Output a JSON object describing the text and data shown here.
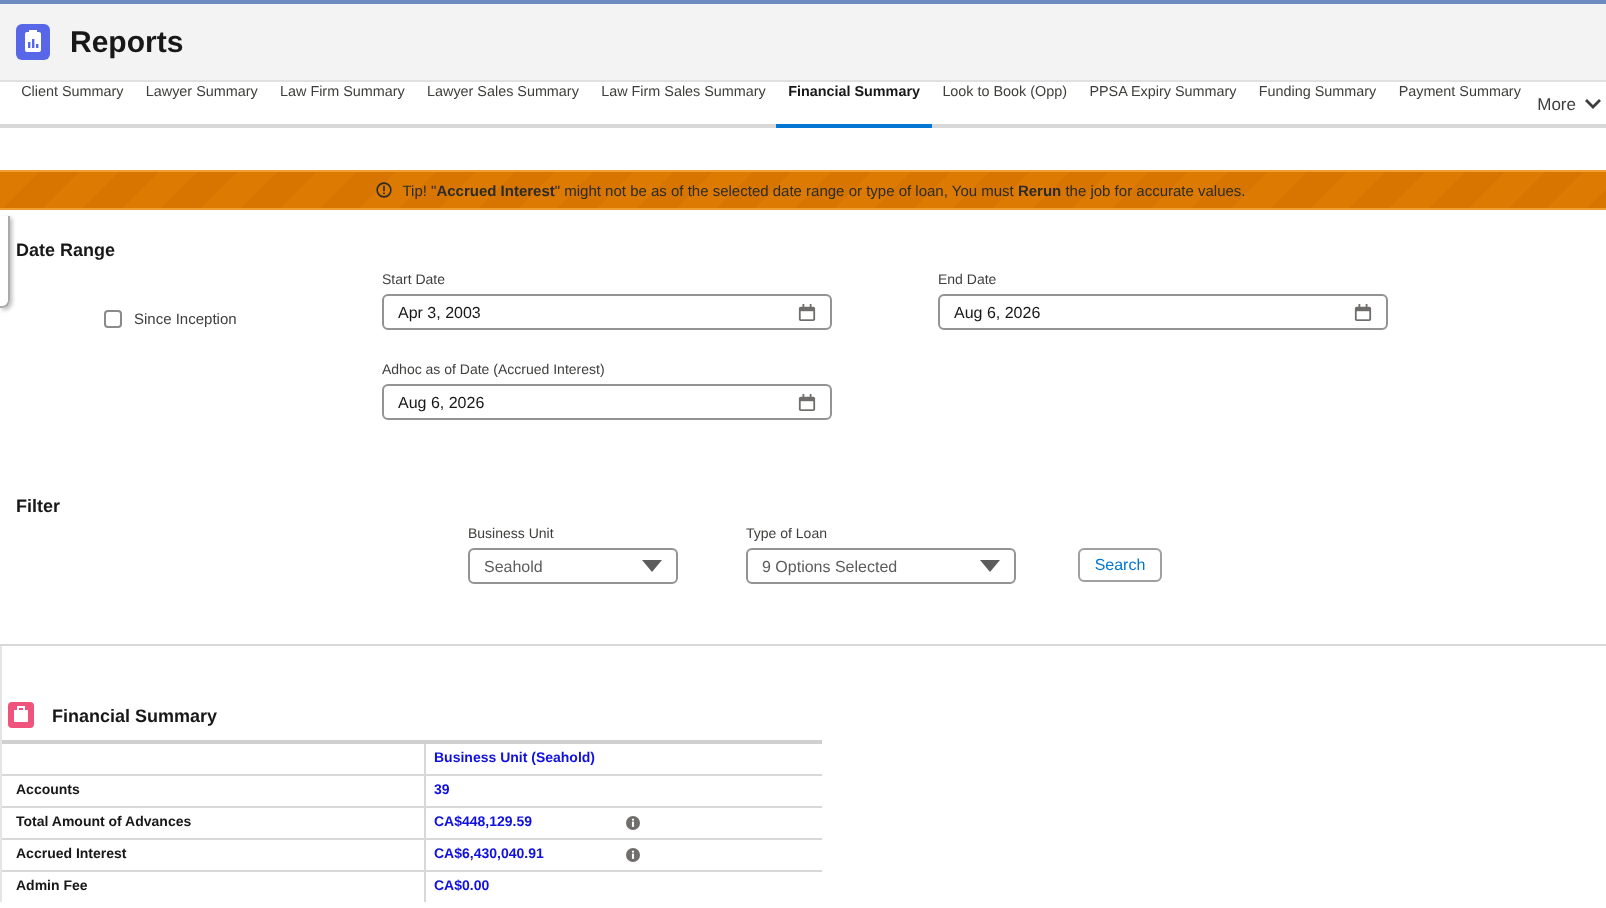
{
  "header": {
    "title": "Reports"
  },
  "tabs": [
    {
      "label": "Client Summary",
      "selected": false
    },
    {
      "label": "Lawyer Summary",
      "selected": false
    },
    {
      "label": "Law Firm Summary",
      "selected": false
    },
    {
      "label": "Lawyer Sales Summary",
      "selected": false
    },
    {
      "label": "Law Firm Sales Summary",
      "selected": false
    },
    {
      "label": "Financial Summary",
      "selected": true
    },
    {
      "label": "Look to Book (Opp)",
      "selected": false
    },
    {
      "label": "PPSA Expiry Summary",
      "selected": false
    },
    {
      "label": "Funding Summary",
      "selected": false
    },
    {
      "label": "Payment Summary",
      "selected": false
    }
  ],
  "more_tab": {
    "label": "More"
  },
  "banner": {
    "text": "Tip! \"**Accrued Interest**\" might not be as of the selected date range or type of loan, You must **Rerun** the job for accurate values."
  },
  "date_range": {
    "title": "Date Range",
    "since_inception": {
      "label": "Since Inception",
      "checked": false
    },
    "start_date": {
      "label": "Start Date",
      "value": "Apr 3, 2003"
    },
    "end_date": {
      "label": "End Date",
      "value": "Aug 6, 2026"
    },
    "adhoc_date": {
      "label": "Adhoc as of Date (Accrued Interest)",
      "value": "Aug 6, 2026"
    }
  },
  "filter": {
    "title": "Filter",
    "business_unit": {
      "label": "Business Unit",
      "value": "Seahold"
    },
    "type_of_loan": {
      "label": "Type of Loan",
      "value": "9 Options Selected"
    },
    "search_button": "Search"
  },
  "financial_summary": {
    "title": "Financial Summary",
    "table": {
      "columns": [
        "Business Unit (Seahold)"
      ],
      "rows": [
        {
          "label": "Accounts",
          "value": "39",
          "info": false
        },
        {
          "label": "Total Amount of Advances",
          "value": "CA$448,129.59",
          "info": true
        },
        {
          "label": "Accrued Interest",
          "value": "CA$6,430,040.91",
          "info": true
        },
        {
          "label": "Admin Fee",
          "value": "CA$0.00",
          "info": false
        }
      ]
    }
  }
}
